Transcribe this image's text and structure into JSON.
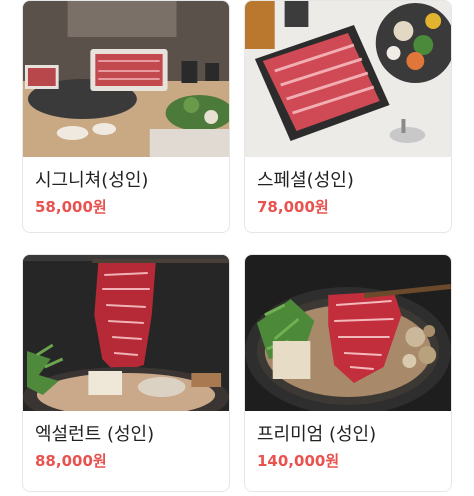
{
  "accent_color": "#e8534f",
  "products": [
    {
      "name": "시그니쳐(성인)",
      "price": "58,000원",
      "image_icon": "signature-shabu-set-photo"
    },
    {
      "name": "스페셜(성인)",
      "price": "78,000원",
      "image_icon": "special-beef-platter-photo"
    },
    {
      "name": "엑설런트 (성인)",
      "price": "88,000원",
      "image_icon": "excellent-marbled-beef-photo"
    },
    {
      "name": "프리미엄 (성인)",
      "price": "140,000원",
      "image_icon": "premium-sukiyaki-photo"
    }
  ]
}
